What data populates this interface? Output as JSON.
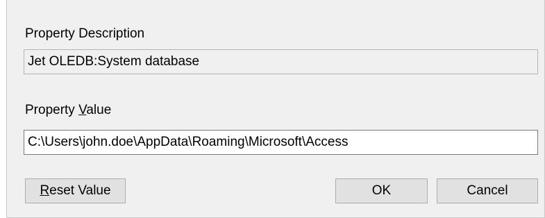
{
  "description": {
    "label": "Property Description",
    "value": "Jet OLEDB:System database"
  },
  "value_section": {
    "label_prefix": "Property ",
    "label_mnemonic": "V",
    "label_suffix": "alue",
    "value": "C:\\Users\\john.doe\\AppData\\Roaming\\Microsoft\\Access"
  },
  "buttons": {
    "reset_mnemonic": "R",
    "reset_suffix": "eset Value",
    "ok": "OK",
    "cancel": "Cancel"
  }
}
